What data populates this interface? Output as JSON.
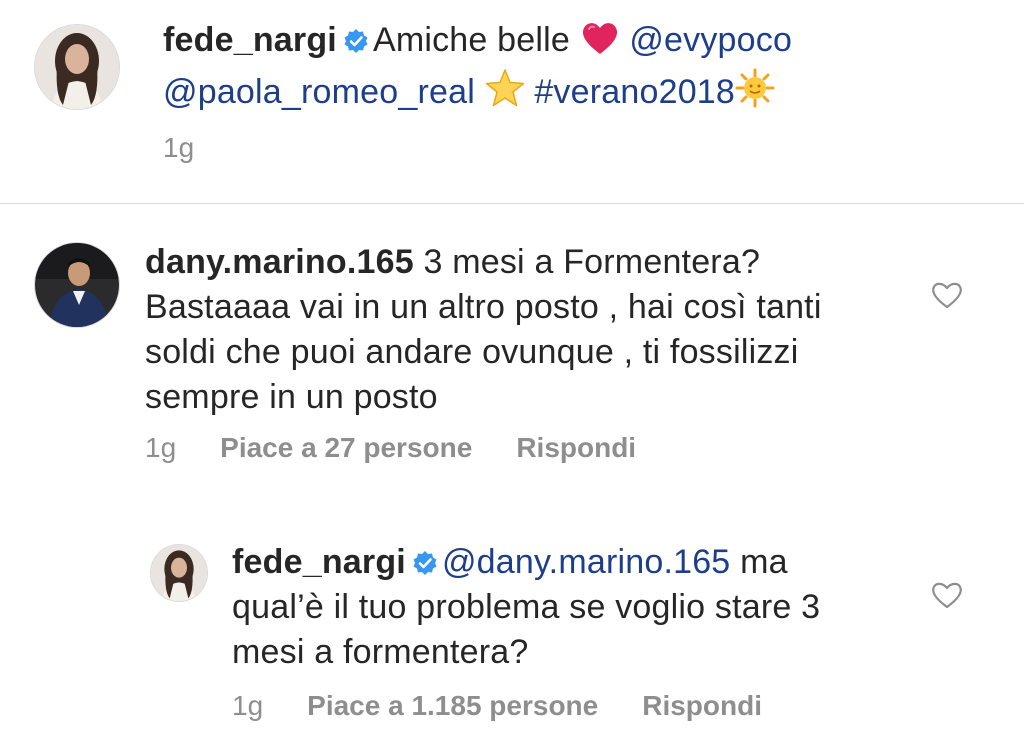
{
  "caption": {
    "username": "fede_nargi",
    "text_1": "Amiche belle",
    "mention_1": "@evypoco",
    "mention_2": "@paola_romeo_real",
    "hashtag": "#verano2018",
    "time": "1g"
  },
  "comment": {
    "username": "dany.marino.165",
    "line_1": "3 mesi a Formentera?",
    "line_2": "Bastaaaa vai in un altro posto , hai così tanti",
    "line_3": "soldi che puoi andare ovunque , ti fossilizzi",
    "line_4": "sempre in un posto",
    "time": "1g",
    "likes": "Piace a 27 persone",
    "reply": "Rispondi"
  },
  "reply": {
    "username": "fede_nargi",
    "mention": "@dany.marino.165",
    "line_1_tail": "ma",
    "line_2": "qual’è il tuo problema se voglio stare 3",
    "line_3": "mesi a formentera?",
    "time": "1g",
    "likes": "Piace a 1.185 persone",
    "reply": "Rispondi"
  },
  "colors": {
    "link": "#1d3e8a",
    "meta": "#8e8e8e",
    "verified": "#3897f0",
    "heart_emoji": "#e0245e"
  },
  "icons": [
    "verified-badge-icon",
    "red-heart-emoji",
    "star-emoji",
    "sun-emoji",
    "like-heart-icon"
  ]
}
